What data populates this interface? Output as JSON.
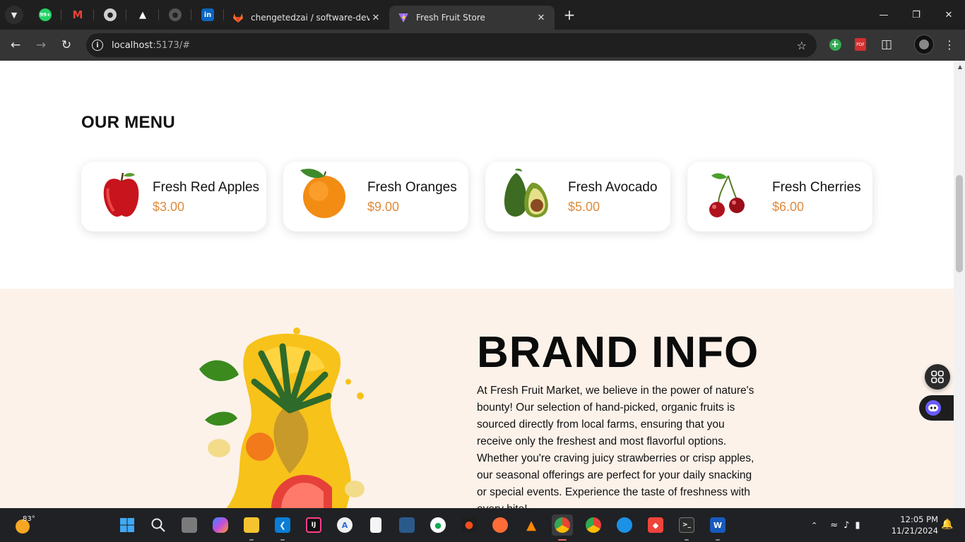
{
  "browser": {
    "tabs": [
      {
        "title": "chengetedzai / software-develo",
        "active": false
      },
      {
        "title": "Fresh Fruit Store",
        "active": true
      }
    ],
    "pinned_badge": "99+",
    "url_host": "localhost",
    "url_rest": ":5173/#"
  },
  "menu": {
    "title": "OUR MENU",
    "items": [
      {
        "name": "Fresh Red Apples",
        "price": "$3.00",
        "icon": "apple-image"
      },
      {
        "name": "Fresh Oranges",
        "price": "$9.00",
        "icon": "orange-image"
      },
      {
        "name": "Fresh Avocado",
        "price": "$5.00",
        "icon": "avocado-image"
      },
      {
        "name": "Fresh Cherries",
        "price": "$6.00",
        "icon": "cherries-image"
      }
    ]
  },
  "brand": {
    "title": "BRAND INFO",
    "text": "At Fresh Fruit Market, we believe in the power of nature's bounty! Our selection of hand-picked, organic fruits is sourced directly from local farms, ensuring that you receive only the freshest and most flavorful options. Whether you're craving juicy strawberries or crisp apples, our seasonal offerings are perfect for your daily snacking or special events. Experience the taste of freshness with every bite!"
  },
  "taskbar": {
    "weather_temp": "83°",
    "time": "12:05 PM",
    "date": "11/21/2024"
  },
  "colors": {
    "price": "#e08a3c",
    "brand_bg": "#fcf2ea",
    "chrome_dark": "#1f1f1f",
    "chrome_toolbar": "#353535"
  }
}
